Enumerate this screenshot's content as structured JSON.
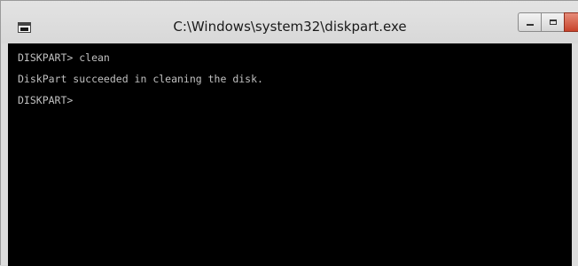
{
  "window": {
    "title": "C:\\Windows\\system32\\diskpart.exe",
    "icon": "console-icon",
    "controls": {
      "minimize": "minimize-icon",
      "maximize": "maximize-icon",
      "close_glyph": "✕"
    }
  },
  "console": {
    "lines": [
      "DISKPART> clean",
      "DiskPart succeeded in cleaning the disk.",
      "DISKPART>"
    ],
    "background": "#000000",
    "foreground": "#c0c0c0"
  },
  "colors": {
    "close_button": "#c8432b",
    "frame": "#dcdcdc"
  }
}
